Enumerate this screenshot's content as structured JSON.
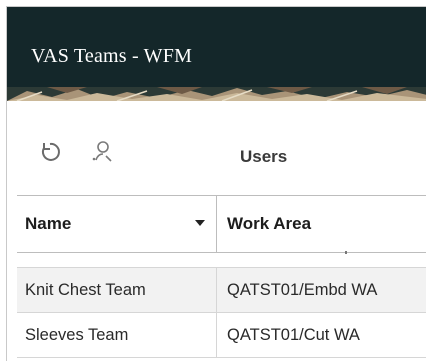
{
  "header": {
    "title": "VAS Teams - WFM"
  },
  "toolbar": {
    "refresh_icon": "refresh-icon",
    "user_icon": "user-search-icon",
    "users_label": "Users"
  },
  "table": {
    "columns": [
      "Name",
      "Work Area"
    ],
    "rows": [
      [
        "Knit Chest Team",
        "QATST01/Embd WA"
      ],
      [
        "Sleeves Team",
        "QATST01/Cut WA"
      ]
    ]
  },
  "colors": {
    "header_bg": "#14272a",
    "row_alt_bg": "#f2f2f2"
  }
}
